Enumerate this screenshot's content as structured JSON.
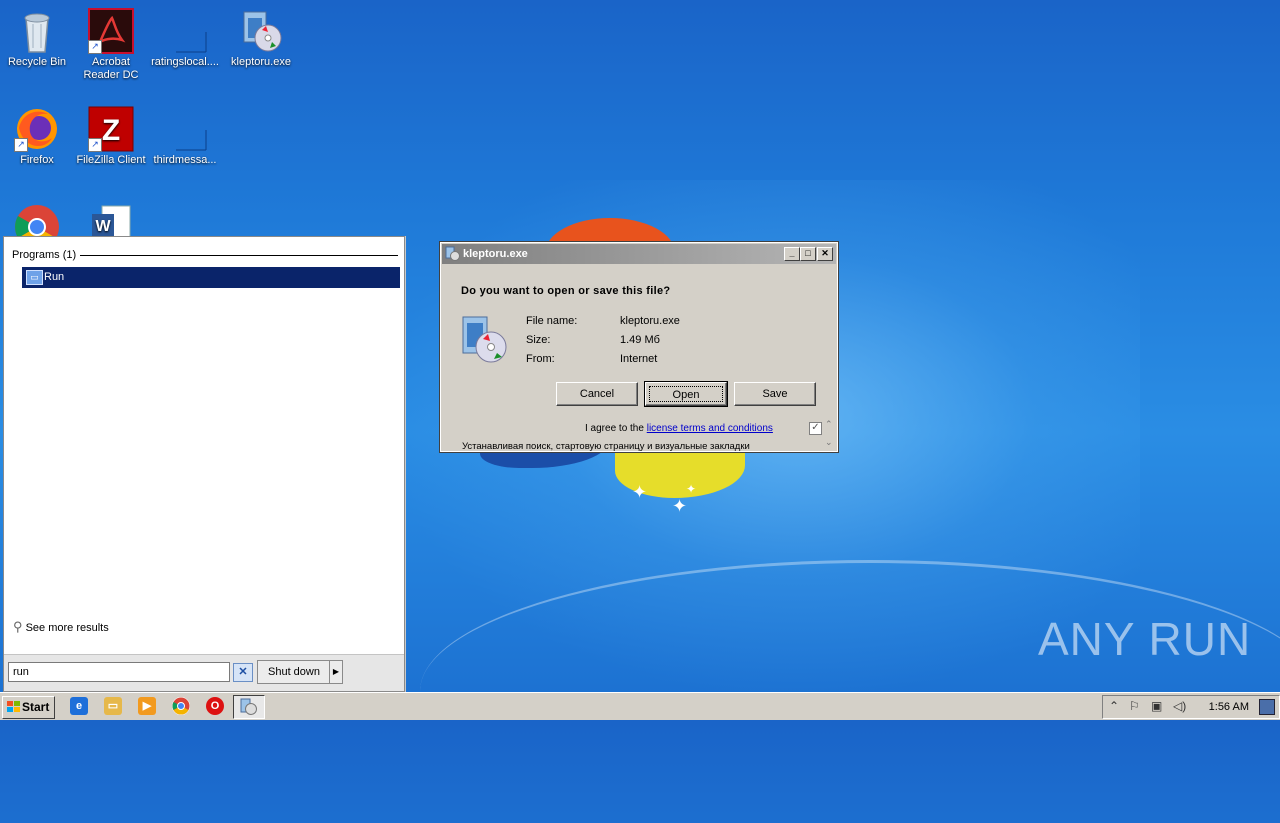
{
  "desktop": {
    "icons": [
      {
        "label": "Recycle Bin"
      },
      {
        "label": "Acrobat Reader DC"
      },
      {
        "label": "ratingslocal...."
      },
      {
        "label": "kleptoru.exe"
      },
      {
        "label": "Firefox"
      },
      {
        "label": "FileZilla Client"
      },
      {
        "label": "thirdmessa..."
      }
    ]
  },
  "start_menu": {
    "section_label": "Programs (1)",
    "result_label": "Run",
    "see_more": "See more results",
    "search_value": "run",
    "shutdown_label": "Shut down"
  },
  "dialog": {
    "title": "kleptoru.exe",
    "question": "Do you want to open or save this file?",
    "file_name_label": "File name:",
    "file_name": "kleptoru.exe",
    "size_label": "Size:",
    "size": "1.49 Мб",
    "from_label": "From:",
    "from": "Internet",
    "cancel_label": "Cancel",
    "open_label": "Open",
    "save_label": "Save",
    "agree_text": "I agree to the",
    "agree_link": "license terms and conditions",
    "russian_text": "Устанавливая поиск, стартовую страницу и визуальные закладки"
  },
  "taskbar": {
    "start_label": "Start",
    "clock": "1:56 AM"
  },
  "watermark": "ANY RUN"
}
